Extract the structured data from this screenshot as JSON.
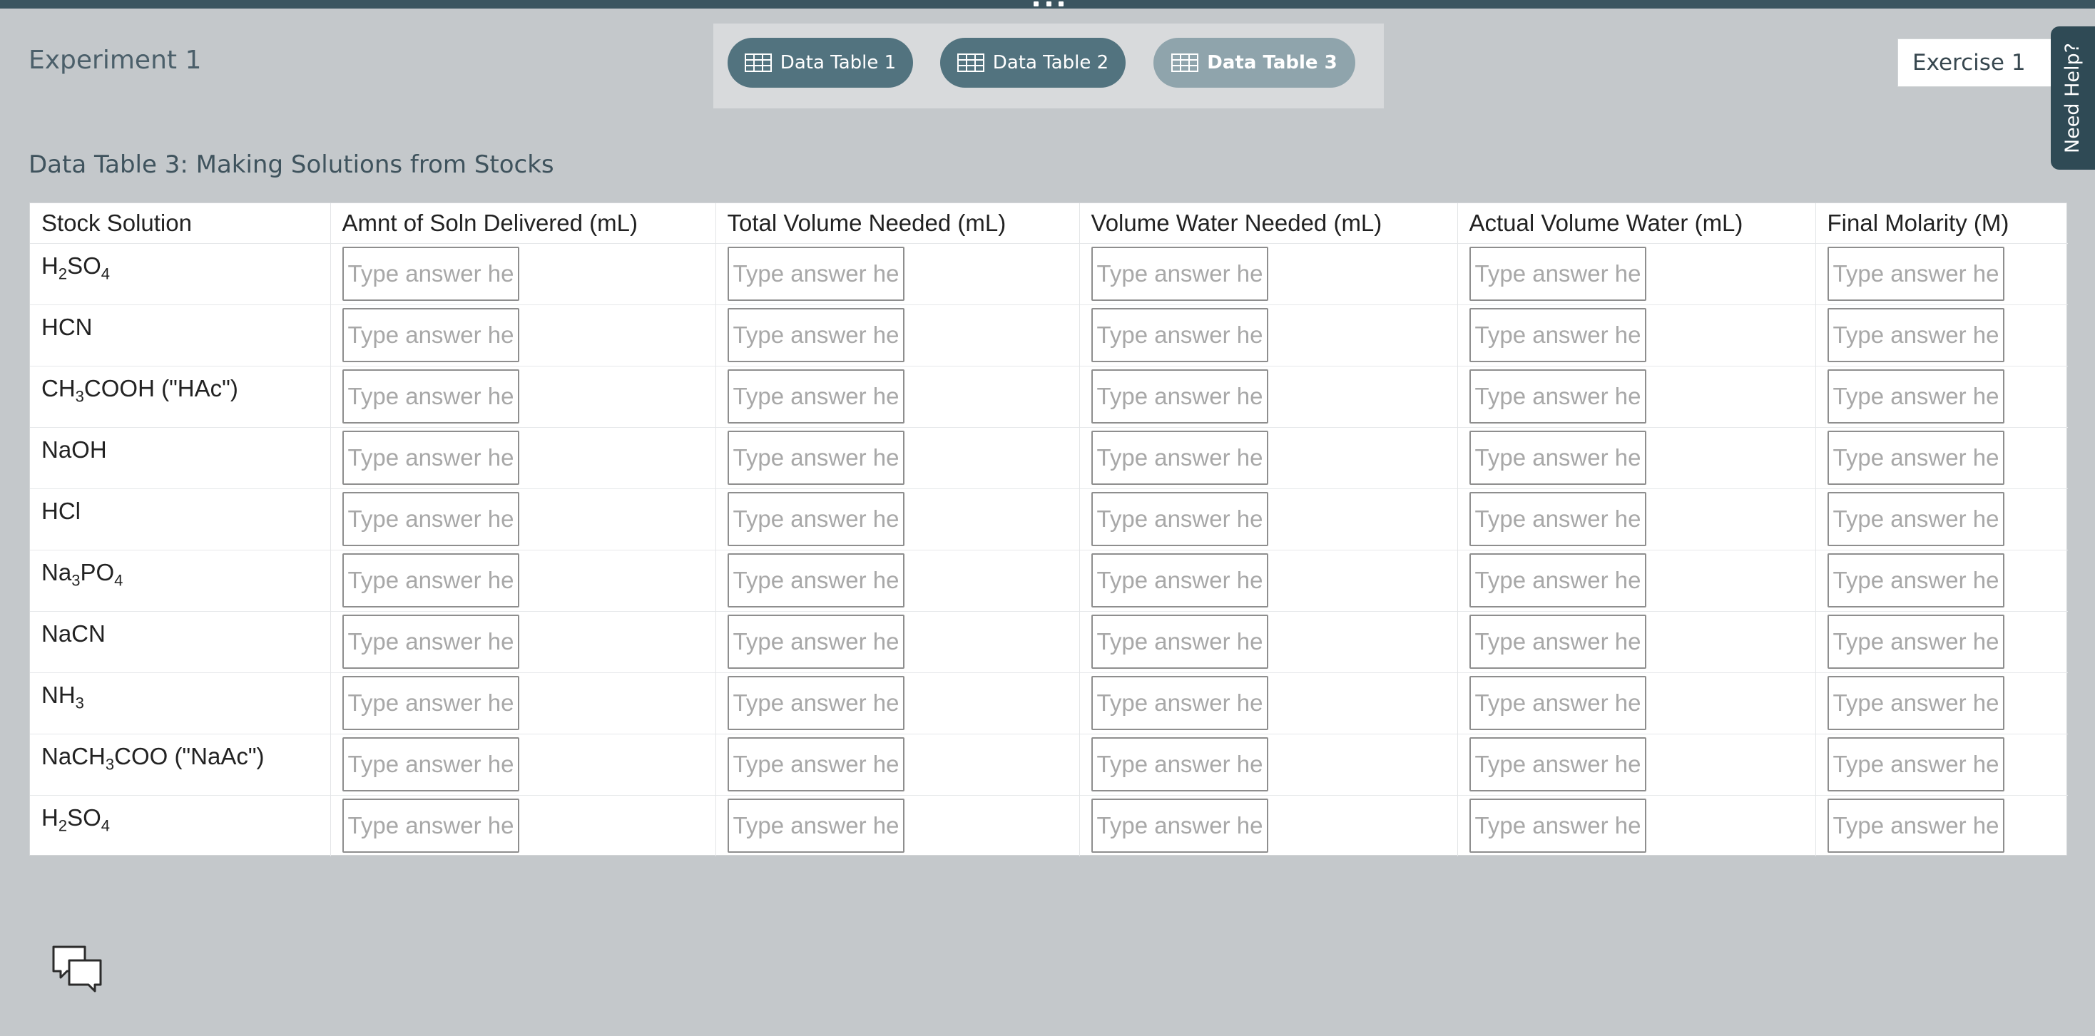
{
  "header": {
    "title": "Experiment 1",
    "tabs": [
      {
        "label": "Data Table 1",
        "active": false
      },
      {
        "label": "Data Table 2",
        "active": false
      },
      {
        "label": "Data Table 3",
        "active": true
      }
    ],
    "exercise_select": {
      "selected": "Exercise 1"
    },
    "need_help": "Need Help?"
  },
  "table": {
    "title": "Data Table 3: Making Solutions from Stocks",
    "columns": [
      "Stock Solution",
      "Amnt of Soln Delivered (mL)",
      "Total Volume Needed (mL)",
      "Volume Water Needed (mL)",
      "Actual Volume Water (mL)",
      "Final Molarity (M)"
    ],
    "input_placeholder": "Type answer here",
    "rows": [
      [
        {
          "t": "H"
        },
        {
          "s": "2"
        },
        {
          "t": "SO"
        },
        {
          "s": "4"
        }
      ],
      [
        {
          "t": "HCN"
        }
      ],
      [
        {
          "t": "CH"
        },
        {
          "s": "3"
        },
        {
          "t": "COOH (\"HAc\")"
        }
      ],
      [
        {
          "t": "NaOH"
        }
      ],
      [
        {
          "t": "HCl"
        }
      ],
      [
        {
          "t": "Na"
        },
        {
          "s": "3"
        },
        {
          "t": "PO"
        },
        {
          "s": "4"
        }
      ],
      [
        {
          "t": "NaCN"
        }
      ],
      [
        {
          "t": "NH"
        },
        {
          "s": "3"
        }
      ],
      [
        {
          "t": "NaCH"
        },
        {
          "s": "3"
        },
        {
          "t": "COO (\"NaAc\")"
        }
      ],
      [
        {
          "t": "H"
        },
        {
          "s": "2"
        },
        {
          "t": "SO"
        },
        {
          "s": "4"
        }
      ]
    ]
  },
  "icons": {
    "tab_icon": "table-icon",
    "chat": "chat-bubbles-icon",
    "caret": "chevron-down-icon",
    "grip": "drag-handle-icon"
  },
  "colors": {
    "background": "#c4c8cb",
    "tab": "#52737f",
    "tab_active": "#8fa4ac",
    "help": "#2f4a55"
  }
}
